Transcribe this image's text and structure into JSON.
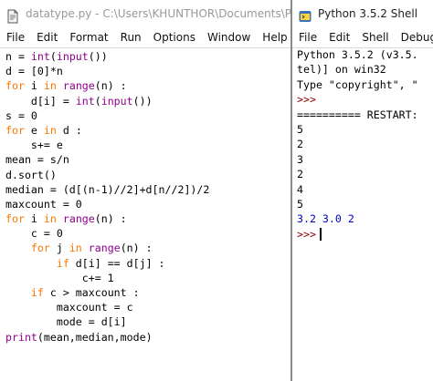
{
  "editor": {
    "title_prefix": "datatype.py - C:\\Users\\KHUNTHOR\\Documents\\Pytho",
    "menu": [
      "File",
      "Edit",
      "Format",
      "Run",
      "Options",
      "Window",
      "Help"
    ],
    "code": [
      [
        [
          "n = ",
          ""
        ],
        [
          "int",
          "bi"
        ],
        [
          "(",
          ""
        ],
        [
          "input",
          "bi"
        ],
        [
          "())",
          ""
        ]
      ],
      [
        [
          "d = [0]*n",
          ""
        ]
      ],
      [
        [
          "for",
          "kw"
        ],
        [
          " i ",
          ""
        ],
        [
          "in",
          "kw"
        ],
        [
          " ",
          ""
        ],
        [
          "range",
          "bi"
        ],
        [
          "(n) :",
          ""
        ]
      ],
      [
        [
          "    d[i] = ",
          ""
        ],
        [
          "int",
          "bi"
        ],
        [
          "(",
          ""
        ],
        [
          "input",
          "bi"
        ],
        [
          "())",
          ""
        ]
      ],
      [
        [
          "s = 0",
          ""
        ]
      ],
      [
        [
          "for",
          "kw"
        ],
        [
          " e ",
          ""
        ],
        [
          "in",
          "kw"
        ],
        [
          " d :",
          ""
        ]
      ],
      [
        [
          "    s+= e",
          ""
        ]
      ],
      [
        [
          "mean = s/n",
          ""
        ]
      ],
      [
        [
          "d.sort()",
          ""
        ]
      ],
      [
        [
          "median = (d[(n-1)//2]+d[n//2])/2",
          ""
        ]
      ],
      [
        [
          "maxcount = 0",
          ""
        ]
      ],
      [
        [
          "for",
          "kw"
        ],
        [
          " i ",
          ""
        ],
        [
          "in",
          "kw"
        ],
        [
          " ",
          ""
        ],
        [
          "range",
          "bi"
        ],
        [
          "(n) :",
          ""
        ]
      ],
      [
        [
          "    c = 0",
          ""
        ]
      ],
      [
        [
          "    ",
          ""
        ],
        [
          "for",
          "kw"
        ],
        [
          " j ",
          ""
        ],
        [
          "in",
          "kw"
        ],
        [
          " ",
          ""
        ],
        [
          "range",
          "bi"
        ],
        [
          "(n) :",
          ""
        ]
      ],
      [
        [
          "        ",
          ""
        ],
        [
          "if",
          "kw"
        ],
        [
          " d[i] == d[j] :",
          ""
        ]
      ],
      [
        [
          "            c+= 1",
          ""
        ]
      ],
      [
        [
          "    ",
          ""
        ],
        [
          "if",
          "kw"
        ],
        [
          " c > maxcount :",
          ""
        ]
      ],
      [
        [
          "        maxcount = c",
          ""
        ]
      ],
      [
        [
          "        mode = d[i]",
          ""
        ]
      ],
      [
        [
          "print",
          "bi"
        ],
        [
          "(mean,median,mode)",
          ""
        ]
      ]
    ]
  },
  "shell": {
    "title": "Python 3.5.2 Shell",
    "menu": [
      "File",
      "Edit",
      "Shell",
      "Debug"
    ],
    "lines": [
      [
        [
          "Python 3.5.2 (v3.5.",
          ""
        ]
      ],
      [
        [
          "tel)] on win32",
          ""
        ]
      ],
      [
        [
          "Type \"copyright\", \"",
          ""
        ]
      ],
      [
        [
          ">>>",
          "prompt"
        ]
      ],
      [
        [
          "========== RESTART:",
          ""
        ]
      ],
      [
        [
          "5",
          ""
        ]
      ],
      [
        [
          "2",
          ""
        ]
      ],
      [
        [
          "3",
          ""
        ]
      ],
      [
        [
          "2",
          ""
        ]
      ],
      [
        [
          "4",
          ""
        ]
      ],
      [
        [
          "5",
          ""
        ]
      ],
      [
        [
          "3.2 3.0 2",
          "out"
        ]
      ],
      [
        [
          ">>>",
          "prompt"
        ]
      ]
    ]
  },
  "colors": {
    "keyword": "#ff7700",
    "builtin": "#900090",
    "output": "#0000c0",
    "prompt": "#8b0000"
  }
}
